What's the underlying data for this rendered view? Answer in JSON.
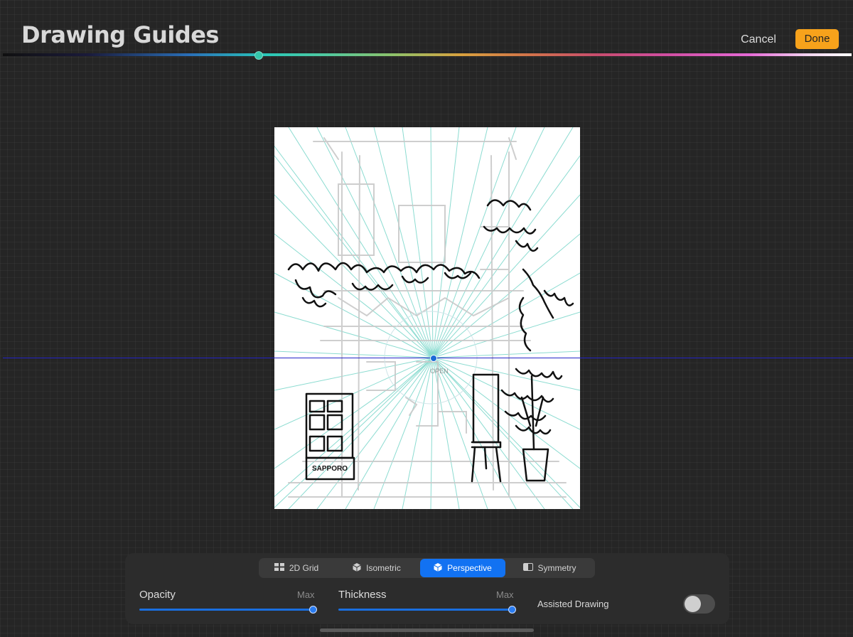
{
  "header": {
    "title": "Drawing Guides",
    "cancel_label": "Cancel",
    "done_label": "Done"
  },
  "color_slider": {
    "selected_color": "#35c6ab"
  },
  "canvas": {
    "sign_text_1": "SAPPORO",
    "sign_text_2": "OPEN",
    "guide_color": "#7fd8cc",
    "horizon_color": "#2424c8"
  },
  "tabs": [
    {
      "label": "2D Grid",
      "icon": "grid-icon"
    },
    {
      "label": "Isometric",
      "icon": "cube-icon"
    },
    {
      "label": "Perspective",
      "icon": "perspective-cube-icon",
      "active": true
    },
    {
      "label": "Symmetry",
      "icon": "symmetry-icon"
    }
  ],
  "opacity": {
    "label": "Opacity",
    "value_label": "Max",
    "level": 1.0
  },
  "thickness": {
    "label": "Thickness",
    "value_label": "Max",
    "level": 1.0
  },
  "assisted_drawing": {
    "label": "Assisted Drawing",
    "enabled": false
  },
  "colors": {
    "accent": "#1272f2",
    "done": "#f7a21b"
  }
}
